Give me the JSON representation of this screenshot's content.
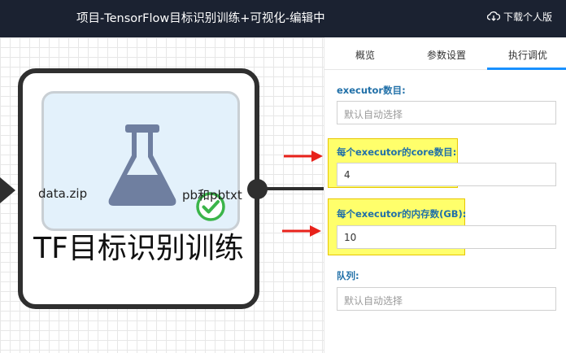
{
  "header": {
    "title": "项目-TensorFlow目标识别训练+可视化-编辑中",
    "download_label": "下载个人版"
  },
  "canvas": {
    "node": {
      "name": "TF目标识别训练",
      "input_label": "data.zip",
      "output_label": "pb和pbtxt",
      "status": "success"
    }
  },
  "panel": {
    "tabs": [
      "概览",
      "参数设置",
      "执行调优"
    ],
    "active_tab": "执行调优",
    "fields": {
      "executor_count": {
        "label": "executor数目:",
        "placeholder": "默认自动选择",
        "value": ""
      },
      "executor_cores": {
        "label": "每个executor的core数目:",
        "value": "4"
      },
      "executor_memory": {
        "label": "每个executor的内存数(GB):",
        "value": "10"
      },
      "queue": {
        "label": "队列:",
        "placeholder": "默认自动选择",
        "value": ""
      }
    }
  },
  "colors": {
    "topbar": "#1b2231",
    "accent": "#1890ff",
    "label": "#2170a8",
    "highlight": "#ffff00",
    "annotation_arrow": "#e8221b",
    "success": "#3bb54a"
  }
}
